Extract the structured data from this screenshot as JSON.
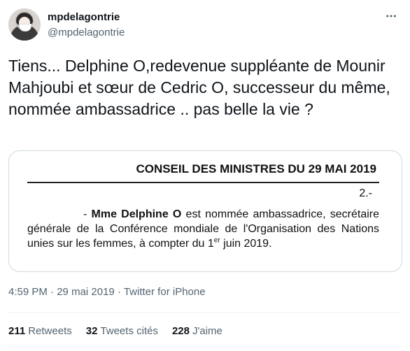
{
  "author": {
    "display_name": "mpdelagontrie",
    "handle": "@mpdelagontrie"
  },
  "more_icon": "more-horizontal-icon",
  "tweet": {
    "text": "Tiens... Delphine O,redevenue suppléante de Mounir Mahjoubi et sœur de Cedric O, successeur du même, nommée ambassadrice .. pas belle la vie ?"
  },
  "document": {
    "title": "CONSEIL DES MINISTRES DU 29 MAI 2019",
    "number": "2.-",
    "dash": "-",
    "name": "Mme Delphine O",
    "text_1": " est nommée ambassadrice, secrétaire générale de la Conférence mondiale de l'Organisation des Nations unies sur les femmes, à compter du 1",
    "sup": "er",
    "text_2": " juin 2019."
  },
  "meta": {
    "time": "4:59 PM",
    "separator": " · ",
    "date": "29 mai 2019",
    "separator2": " · ",
    "source": "Twitter for iPhone"
  },
  "stats": {
    "retweets_count": "211",
    "retweets_label": "Retweets",
    "quotes_count": "32",
    "quotes_label": "Tweets cités",
    "likes_count": "228",
    "likes_label": "J'aime"
  }
}
